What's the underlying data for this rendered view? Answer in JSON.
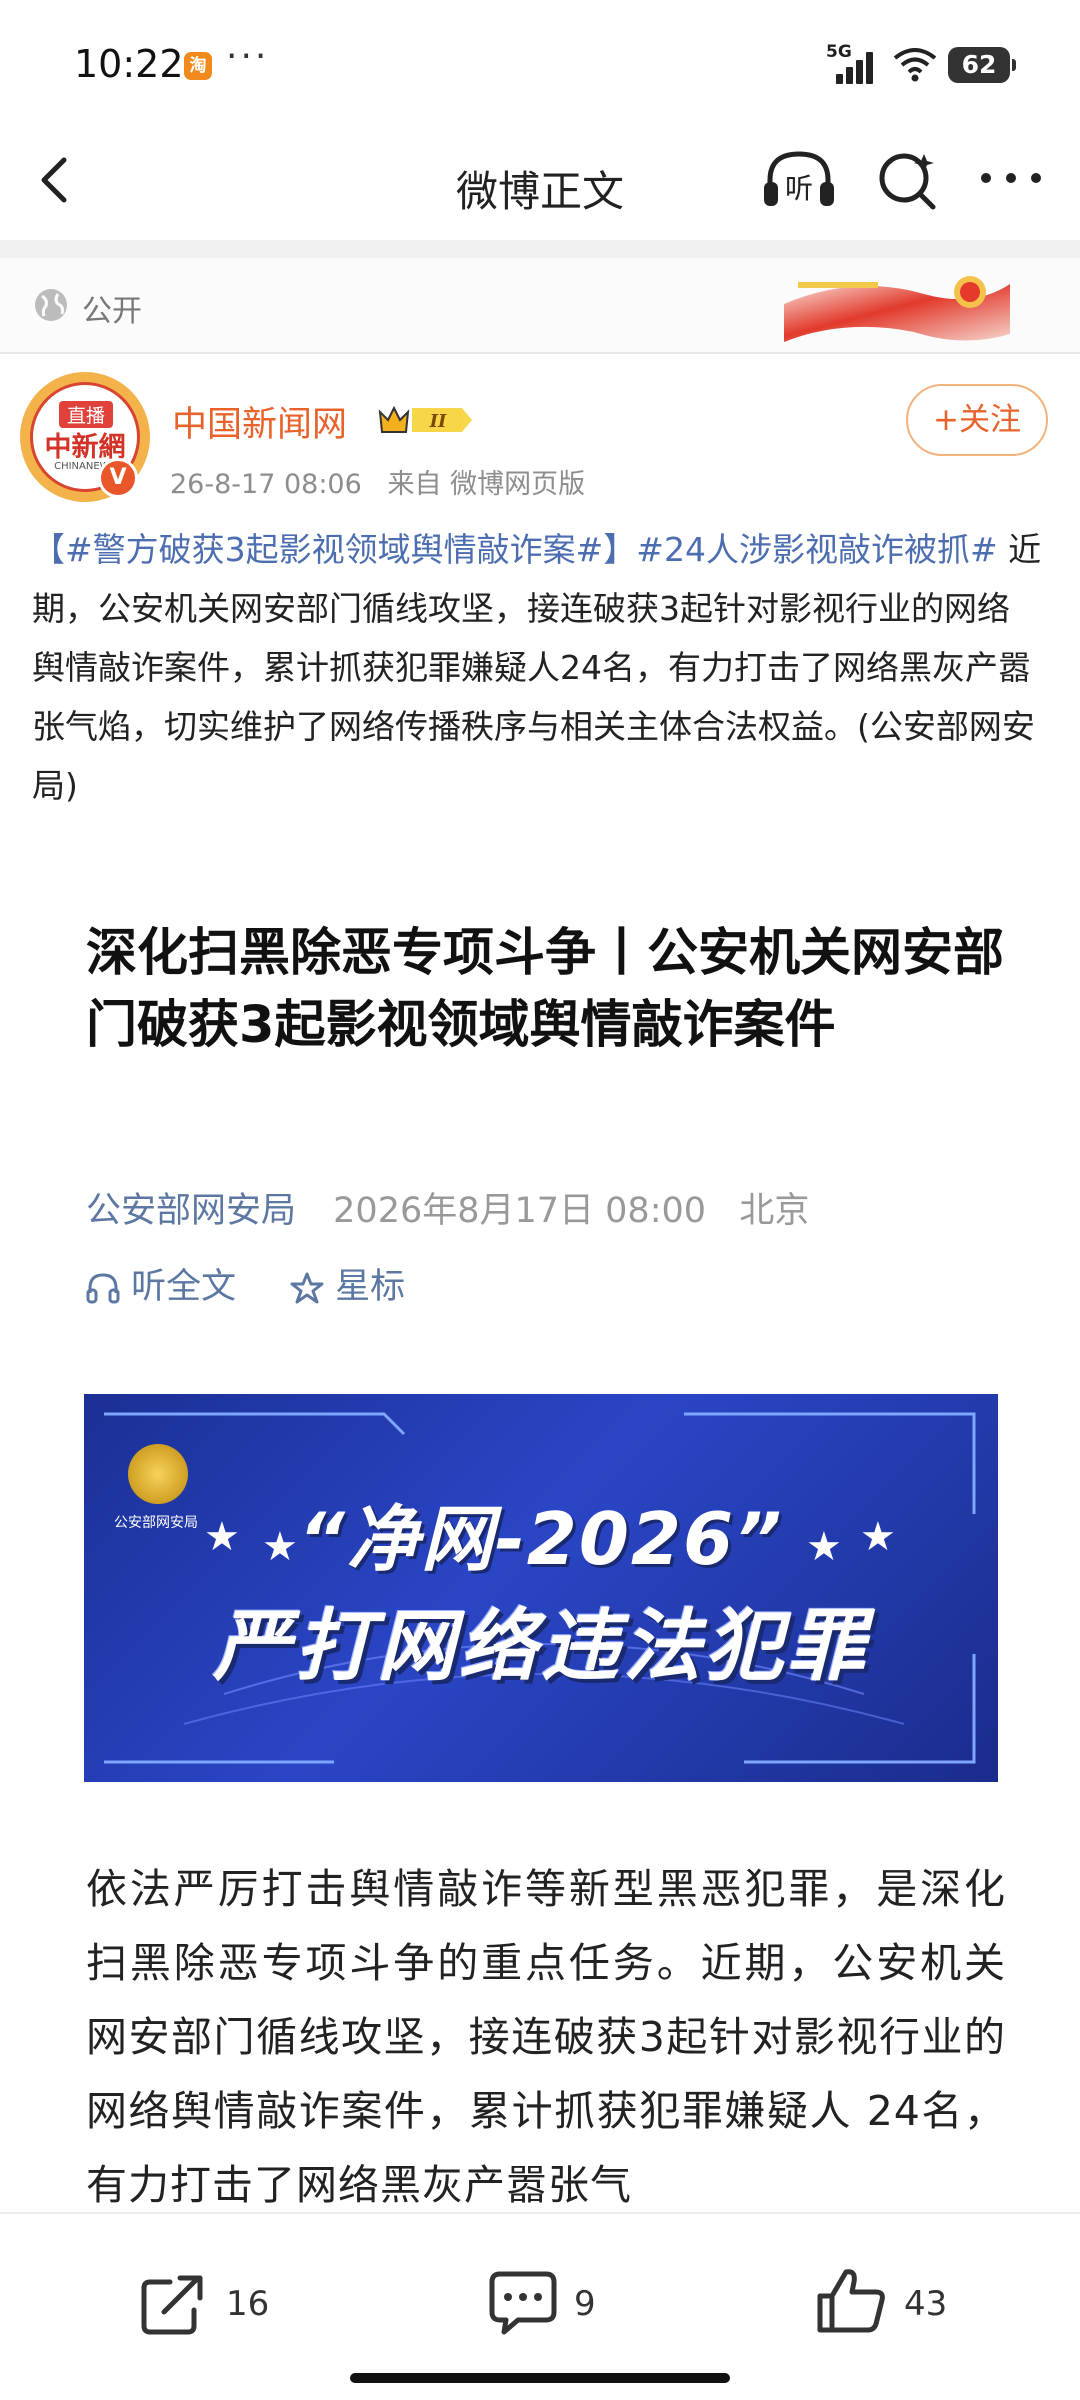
{
  "status_bar": {
    "time": "10:22",
    "app_icon_glyph": "淘",
    "more_dots": "···",
    "network": "5G",
    "battery": "62"
  },
  "nav": {
    "title": "微博正文",
    "listen_label": "听"
  },
  "visibility": {
    "label": "公开"
  },
  "author": {
    "name": "中国新闻网",
    "level_badge": "II",
    "avatar_live_label": "直播",
    "avatar_logo_text": "中新網",
    "avatar_logo_sub": "CHINANEWS",
    "verified_mark": "V",
    "post_time": "26-8-17 08:06",
    "post_source": "来自 微博网页版",
    "follow_label": "+关注"
  },
  "post": {
    "hashtag_1": "【#警方破获3起影视领域舆情敲诈案#】",
    "hashtag_2": "#24人涉影视敲诈被抓#",
    "body": " 近期，公安机关网安部门循线攻坚，接连破获3起针对影视行业的网络舆情敲诈案件，累计抓获犯罪嫌疑人24名，有力打击了网络黑灰产嚣张气焰，切实维护了网络传播秩序与相关主体合法权益。(公安部网安局)"
  },
  "article": {
    "title": "深化扫黑除恶专项斗争丨公安机关网安部门破获3起影视领域舆情敲诈案件",
    "source": "公安部网安局",
    "date": "2026年8月17日 08:00",
    "location": "北京",
    "listen_label": "听全文",
    "star_label": "星标",
    "banner": {
      "org": "公安部网安局",
      "line1": "“净网-2026”",
      "line2": "严打网络违法犯罪"
    },
    "body": "依法严厉打击舆情敲诈等新型黑恶犯罪，是深化扫黑除恶专项斗争的重点任务。近期，公安机关网安部门循线攻坚，接连破获3起针对影视行业的网络舆情敲诈案件，累计抓获犯罪嫌疑人 24名，有力打击了网络黑灰产嚣张气"
  },
  "bottom_bar": {
    "share_count": "16",
    "comment_count": "9",
    "like_count": "43"
  },
  "colors": {
    "accent_orange": "#e8632c",
    "link_blue": "#4c6eb0",
    "banner_blue": "#2a46c6"
  }
}
